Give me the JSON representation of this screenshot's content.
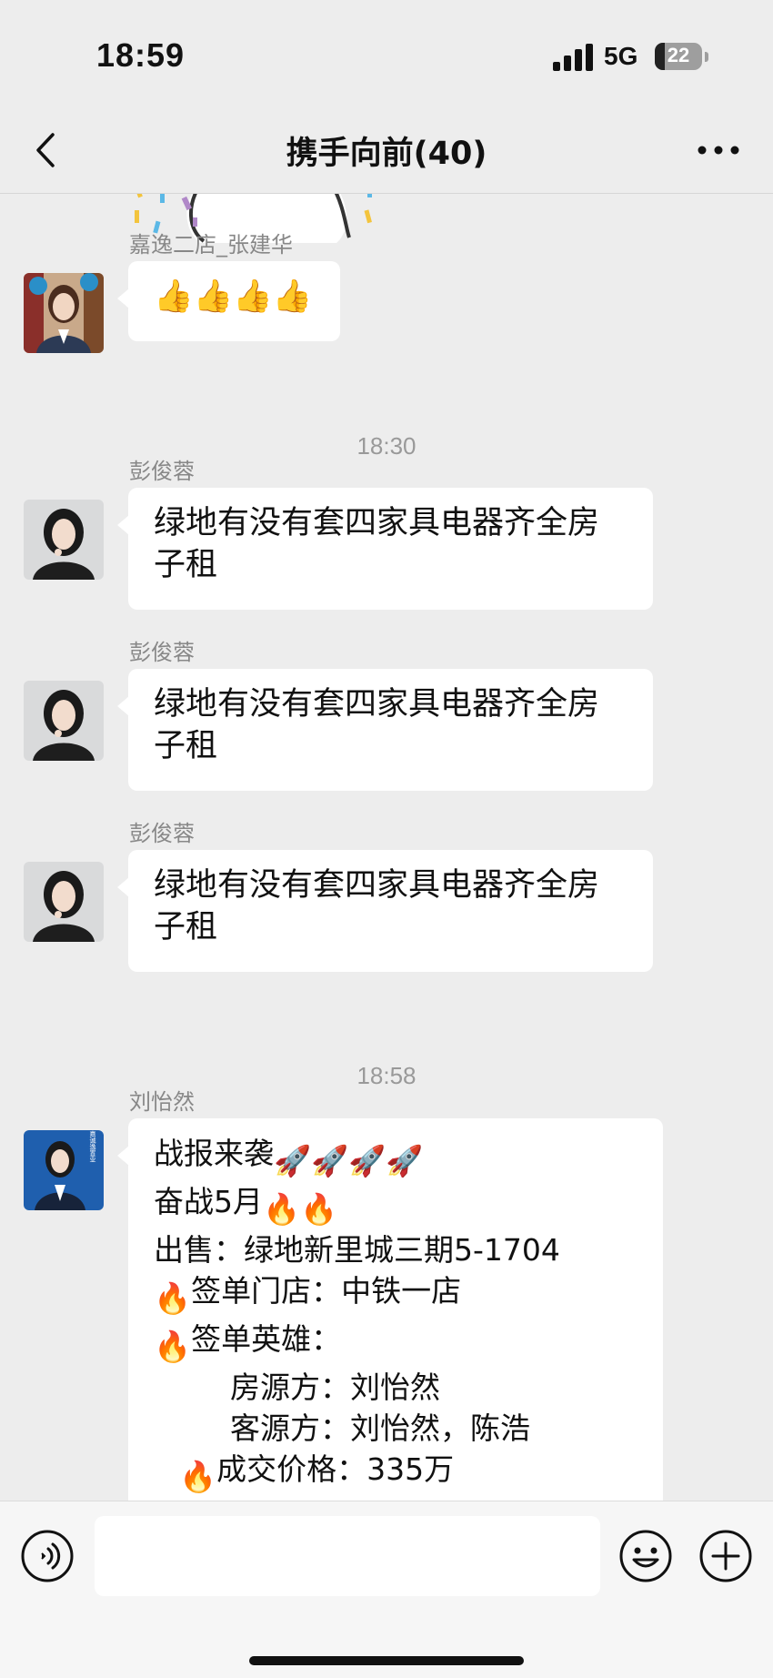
{
  "status_bar": {
    "time": "18:59",
    "network": "5G",
    "battery": "22",
    "battery_percent": 22
  },
  "header": {
    "title": "携手向前(40)"
  },
  "messages": [
    {
      "sender": "嘉逸二店_张建华",
      "text": "👍👍👍👍"
    },
    {
      "timestamp": "18:30"
    },
    {
      "sender": "彭俊蓉",
      "line1": "绿地有没有套四家具电器齐全房",
      "line2": "子租"
    },
    {
      "sender": "彭俊蓉",
      "line1": "绿地有没有套四家具电器齐全房",
      "line2": "子租"
    },
    {
      "sender": "彭俊蓉",
      "line1": "绿地有没有套四家具电器齐全房",
      "line2": "子租"
    },
    {
      "timestamp": "18:58"
    },
    {
      "sender": "刘怡然",
      "avatar_text": "嘉诚逸置业",
      "lines": [
        "战报来袭",
        "奋战5月",
        "出售：绿地新里城三期5-1704",
        "签单门店：中铁一店",
        "签单英雄：",
        "房源方：刘怡然",
        "客源方：刘怡然，陈浩",
        "成交价格：335万"
      ]
    }
  ],
  "colors": {
    "background": "#ededed",
    "bubble": "#ffffff",
    "sender": "#888888",
    "timestamp": "#999999"
  },
  "icons": {
    "back": "chevron-left-icon",
    "more": "more-dots-icon",
    "voice": "voice-icon",
    "emoji": "smile-icon",
    "plus": "plus-icon"
  }
}
